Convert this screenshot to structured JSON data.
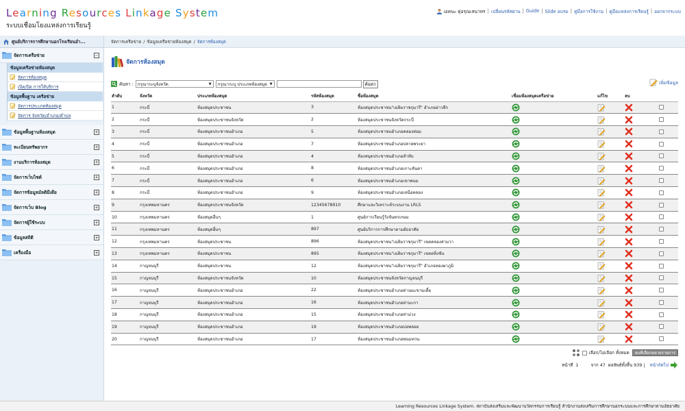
{
  "header": {
    "title_letters": [
      {
        "ch": "L",
        "color": "#6a2c91"
      },
      {
        "ch": "e",
        "color": "#e03a3a"
      },
      {
        "ch": "a",
        "color": "#1f8de0"
      },
      {
        "ch": "r",
        "color": "#f2a01c"
      },
      {
        "ch": "n",
        "color": "#2aa03a"
      },
      {
        "ch": "i",
        "color": "#e03a3a"
      },
      {
        "ch": "n",
        "color": "#1f8de0"
      },
      {
        "ch": "g",
        "color": "#6a2c91"
      },
      {
        "ch": " ",
        "color": "#000"
      },
      {
        "ch": "R",
        "color": "#2aa03a"
      },
      {
        "ch": "e",
        "color": "#f2a01c"
      },
      {
        "ch": "s",
        "color": "#e03a3a"
      },
      {
        "ch": "o",
        "color": "#1f8de0"
      },
      {
        "ch": "u",
        "color": "#6a2c91"
      },
      {
        "ch": "r",
        "color": "#2aa03a"
      },
      {
        "ch": "c",
        "color": "#e03a3a"
      },
      {
        "ch": "e",
        "color": "#f2a01c"
      },
      {
        "ch": "s",
        "color": "#1f8de0"
      },
      {
        "ch": " ",
        "color": "#000"
      },
      {
        "ch": "L",
        "color": "#e03a3a"
      },
      {
        "ch": "i",
        "color": "#2aa03a"
      },
      {
        "ch": "n",
        "color": "#1f8de0"
      },
      {
        "ch": "k",
        "color": "#f2a01c"
      },
      {
        "ch": "a",
        "color": "#6a2c91"
      },
      {
        "ch": "g",
        "color": "#e03a3a"
      },
      {
        "ch": "e",
        "color": "#2aa03a"
      },
      {
        "ch": " ",
        "color": "#000"
      },
      {
        "ch": "S",
        "color": "#1f8de0"
      },
      {
        "ch": "y",
        "color": "#f2a01c"
      },
      {
        "ch": "s",
        "color": "#e03a3a"
      },
      {
        "ch": "t",
        "color": "#6a2c91"
      },
      {
        "ch": "e",
        "color": "#2aa03a"
      },
      {
        "ch": "m",
        "color": "#1f8de0"
      }
    ],
    "subtitle": "ระบบเชื่อมโยงแหล่งการเรียนรู้",
    "user_name": "เอคนะ ดุ่อรุณเสนาทร",
    "nav": [
      "เปลี่ยนรหัสผ่าน",
      "Guide",
      "Slide อบรม",
      "คู่มือการใช้งาน",
      "คู่มือแหล่งการเรียนรู้",
      "ออกจากระบบ"
    ]
  },
  "sidebar": {
    "head": "ศูนย์บริการการศึกษานอกโรงเรียนอำ...",
    "sections": [
      {
        "label": "จัดการเครือข่าย",
        "toggle": "−",
        "groups": [
          {
            "head": "ข้อมูลเครือข่ายห้องสมุด",
            "items": [
              "จัดการห้องสมุด",
              "เปิด/ปิด การให้บริการ"
            ]
          },
          {
            "head": "ข้อมูลพื้นฐาน เครือข่าย",
            "items": [
              "จัดการประเภทห้องสมุด",
              "จัดการ จังหวัด/อำเภอ/ตำบล"
            ]
          }
        ]
      },
      {
        "label": "ข้อมูลพื้นฐานห้องสมุด",
        "toggle": "+"
      },
      {
        "label": "ทะเบียนทรัพยากร",
        "toggle": "+"
      },
      {
        "label": "งานบริการห้องสมุด",
        "toggle": "+"
      },
      {
        "label": "จัดการเว็บไซต์",
        "toggle": "+"
      },
      {
        "label": "จัดการข้อมูลมัลติมีเดีย",
        "toggle": "+"
      },
      {
        "label": "จัดการเว็บ Blog",
        "toggle": "+"
      },
      {
        "label": "จัดการผู้ใช้ระบบ",
        "toggle": "+"
      },
      {
        "label": "ข้อมูลสถิติ",
        "toggle": "+"
      },
      {
        "label": "เครื่องมือ",
        "toggle": "+"
      }
    ]
  },
  "breadcrumb": [
    "จัดการเครือข่าย",
    "ข้อมูลเครือข่ายห้องสมุด",
    "จัดการห้องสมุด"
  ],
  "page_title": "จัดการห้องสมุด",
  "search": {
    "label": "ค้นหา :",
    "province_select": "กรุณาระบุจังหวัด",
    "type_select": "กรุณาระบุ ประเภทห้องสมุด",
    "button": "ค้นหา",
    "add_label": "เพิ่มข้อมูล"
  },
  "table": {
    "headers": [
      "ลำดับ",
      "จังหวัด",
      "ประเภทห้องสมุด",
      "รหัสห้องสมุด",
      "ชื่อห้องสมุด",
      "เชื่อมห้องสมุดเครือข่าย",
      "แก้ไข",
      "ลบ",
      ""
    ],
    "rows": [
      [
        "1",
        "กระบี่",
        "ห้องสมุดประชาชน",
        "3",
        "ห้องสมุดประชาชน\"เฉลิมราชกุมารี\" อำเภออ่าวลึก"
      ],
      [
        "2",
        "กระบี่",
        "ห้องสมุดประชาชนจังหวัด",
        "2",
        "ห้องสมุดประชาชนจังหวัดกระบี่"
      ],
      [
        "3",
        "กระบี่",
        "ห้องสมุดประชาชนอำเภอ",
        "5",
        "ห้องสมุดประชาชนอำเภอคลองท่อม"
      ],
      [
        "4",
        "กระบี่",
        "ห้องสมุดประชาชนอำเภอ",
        "7",
        "ห้องสมุดประชาชนอำเภอปลายพระยา"
      ],
      [
        "5",
        "กระบี่",
        "ห้องสมุดประชาชนอำเภอ",
        "4",
        "ห้องสมุดประชาชนอำเภอลำทับ"
      ],
      [
        "6",
        "กระบี่",
        "ห้องสมุดประชาชนอำเภอ",
        "8",
        "ห้องสมุดประชาชนอำเภอเกาะลันตา"
      ],
      [
        "7",
        "กระบี่",
        "ห้องสมุดประชาชนอำเภอ",
        "6",
        "ห้องสมุดประชาชนอำเภอเขาพนม"
      ],
      [
        "8",
        "กระบี่",
        "ห้องสมุดประชาชนอำเภอ",
        "9",
        "ห้องสมุดประชาชนอำเภอเหนือคลอง"
      ],
      [
        "9",
        "กรุงเทพมหานคร",
        "ห้องสมุดประชาชนจังหวัด",
        "12345678910",
        "ศึกษาและวิเคราะห์ระบบงาน LRLS"
      ],
      [
        "10",
        "กรุงเทพมหานคร",
        "ห้องสมุดอื่นๆ",
        "1",
        "ศูนย์การเรียนรู้วังจันทรเกษม"
      ],
      [
        "11",
        "กรุงเทพมหานคร",
        "ห้องสมุดอื่นๆ",
        "897",
        "ศูนย์บริการการศึกษาตามอัธยาศัย"
      ],
      [
        "12",
        "กรุงเทพมหานคร",
        "ห้องสมุดประชาชน",
        "896",
        "ห้องสมุดประชาชน\"เฉลิมราชกุมารี\" เขตคลองสามวา"
      ],
      [
        "13",
        "กรุงเทพมหานคร",
        "ห้องสมุดประชาชน",
        "895",
        "ห้องสมุดประชาชน\"เฉลิมราชกุมารี\" เขตตลิ่งชัน"
      ],
      [
        "14",
        "กาญจนบุรี",
        "ห้องสมุดประชาชน",
        "12",
        "ห้องสมุดประชาชน\"เฉลิมราชกุมารี\" อำเภอทองผาภูมิ"
      ],
      [
        "15",
        "กาญจนบุรี",
        "ห้องสมุดประชาชนจังหวัด",
        "10",
        "ห้องสมุดประชาชนจังหวัดกาญจนบุรี"
      ],
      [
        "16",
        "กาญจนบุรี",
        "ห้องสมุดประชาชนอำเภอ",
        "22",
        "ห้องสมุดประชาชนอำเภอด่านมะขามเตี้ย"
      ],
      [
        "17",
        "กาญจนบุรี",
        "ห้องสมุดประชาชนอำเภอ",
        "16",
        "ห้องสมุดประชาชนอำเภอท่ามะกา"
      ],
      [
        "18",
        "กาญจนบุรี",
        "ห้องสมุดประชาชนอำเภอ",
        "15",
        "ห้องสมุดประชาชนอำเภอท่าม่วง"
      ],
      [
        "19",
        "กาญจนบุรี",
        "ห้องสมุดประชาชนอำเภอ",
        "19",
        "ห้องสมุดประชาชนอำเภอบ่อพลอย"
      ],
      [
        "20",
        "กาญจนบุรี",
        "ห้องสมุดประชาชนอำเภอ",
        "17",
        "ห้องสมุดประชาชนอำเภอพนมทวน"
      ]
    ]
  },
  "footer_tools": {
    "select_all": "เลือก/ไม่เลือก ทั้งหมด",
    "delete_selected": "ลบที่เลือกหลายรายการ"
  },
  "pager": {
    "page_label": "หน้าที่",
    "page_value": "1",
    "of_label": "จาก 47",
    "total_label": "ผลลัพธ์ทั้งสิ้น 939",
    "next_label": "หน้าถัดไป"
  },
  "footer": "Learning Resources Linkage System. สถาบันส่งเสริมและพัฒนานวัตกรรมการเรียนรู้ สำนักงานส่งเสริมการศึกษานอกระบบและการศึกษาตามอัธยาศัย"
}
